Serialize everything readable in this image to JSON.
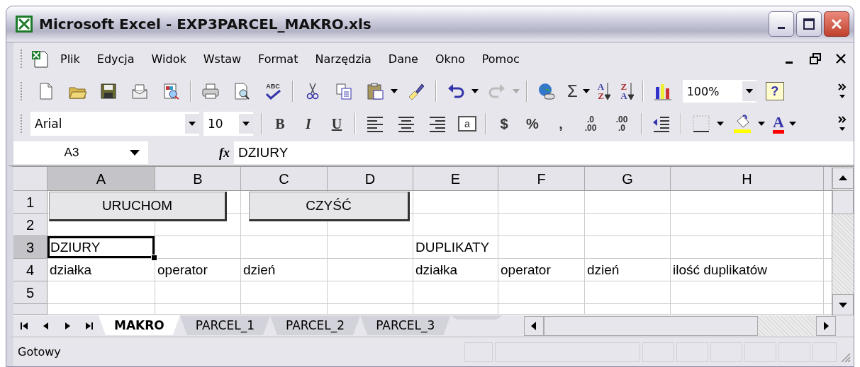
{
  "window": {
    "title": "Microsoft Excel - EXP3PARCEL_MAKRO.xls"
  },
  "menu": {
    "items": [
      "Plik",
      "Edycja",
      "Widok",
      "Wstaw",
      "Format",
      "Narzędzia",
      "Dane",
      "Okno",
      "Pomoc"
    ]
  },
  "standard_toolbar": {
    "spelling": "ABC",
    "sum": "Σ",
    "sort_ascending": [
      "A",
      "Z"
    ],
    "sort_descending": [
      "Z",
      "A"
    ],
    "zoom": "100%",
    "help": "?"
  },
  "formatting_toolbar": {
    "font": "Arial",
    "size": "10",
    "bold": "B",
    "italic": "I",
    "underline": "U",
    "merge": "a",
    "currency": "$",
    "percent": "%",
    "comma": ",",
    "increase_decimal": [
      ".0",
      ".00"
    ],
    "decrease_decimal": [
      ".00",
      ".0"
    ],
    "font_color": "A"
  },
  "formula_bar": {
    "name_box": "A3",
    "fx": "fx",
    "value": "DZIURY"
  },
  "sheet": {
    "columns": [
      {
        "label": "A",
        "selected": true
      },
      {
        "label": "B",
        "selected": false
      },
      {
        "label": "C",
        "selected": false
      },
      {
        "label": "D",
        "selected": false
      },
      {
        "label": "E",
        "selected": false
      },
      {
        "label": "F",
        "selected": false
      },
      {
        "label": "G",
        "selected": false
      },
      {
        "label": "H",
        "selected": false
      }
    ],
    "rows": [
      {
        "label": "1",
        "selected": false,
        "cells": [
          null,
          null,
          null,
          null,
          null,
          null,
          null,
          null
        ]
      },
      {
        "label": "2",
        "selected": false,
        "cells": [
          null,
          null,
          null,
          null,
          null,
          null,
          null,
          null
        ]
      },
      {
        "label": "3",
        "selected": true,
        "cells": [
          {
            "text": "DZIURY",
            "active": true
          },
          null,
          null,
          null,
          {
            "text": "DUPLIKATY",
            "active": false
          },
          null,
          null,
          null
        ]
      },
      {
        "label": "4",
        "selected": false,
        "cells": [
          {
            "text": "działka",
            "active": false
          },
          {
            "text": "operator",
            "active": false
          },
          {
            "text": "dzień",
            "active": false
          },
          null,
          {
            "text": "działka",
            "active": false
          },
          {
            "text": "operator",
            "active": false
          },
          {
            "text": "dzień",
            "active": false
          },
          {
            "text": "ilość duplikatów",
            "active": false
          }
        ]
      },
      {
        "label": "5",
        "selected": false,
        "cells": [
          null,
          null,
          null,
          null,
          null,
          null,
          null,
          null
        ]
      }
    ],
    "buttons": [
      "URUCHOM",
      "CZYŚĆ"
    ]
  },
  "sheet_tabs": [
    {
      "label": "MAKRO",
      "selected": true
    },
    {
      "label": "PARCEL_1",
      "selected": false
    },
    {
      "label": "PARCEL_2",
      "selected": false
    },
    {
      "label": "PARCEL_3",
      "selected": false
    }
  ],
  "status_bar": {
    "text": "Gotowy"
  }
}
